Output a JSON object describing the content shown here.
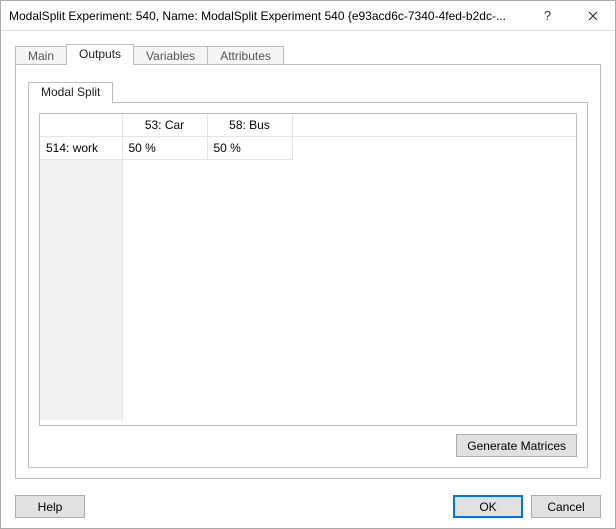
{
  "window": {
    "title": "ModalSplit Experiment: 540, Name: ModalSplit Experiment 540  {e93acd6c-7340-4fed-b2dc-..."
  },
  "tabs": {
    "main": "Main",
    "outputs": "Outputs",
    "variables": "Variables",
    "attributes": "Attributes"
  },
  "inner_tab": {
    "modal_split": "Modal Split"
  },
  "grid": {
    "col1": "53: Car",
    "col2": "58: Bus",
    "rowhdr": "514: work",
    "cell_a": "50 %",
    "cell_b": "50 %"
  },
  "buttons": {
    "generate": "Generate Matrices",
    "help": "Help",
    "ok": "OK",
    "cancel": "Cancel"
  }
}
